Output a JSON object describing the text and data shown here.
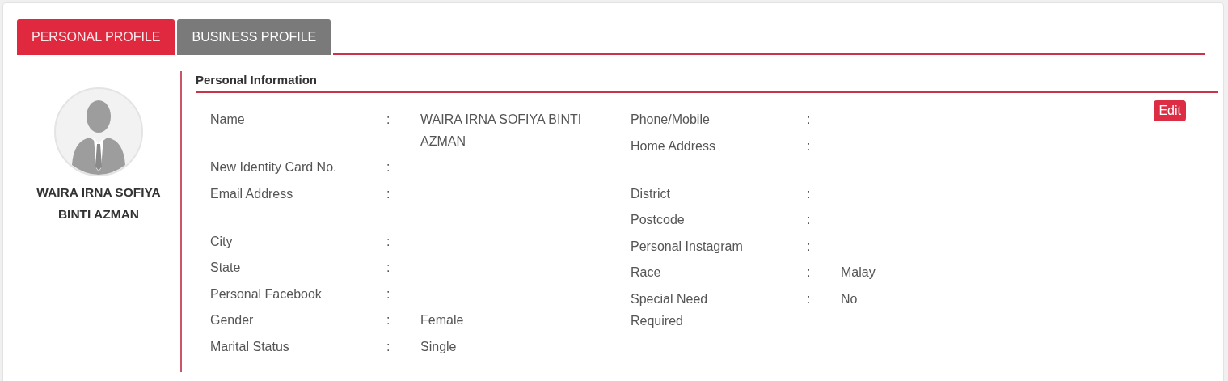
{
  "tabs": [
    {
      "label": "PERSONAL PROFILE",
      "selected": true
    },
    {
      "label": "BUSINESS PROFILE",
      "selected": false
    }
  ],
  "profile": {
    "name": "WAIRA IRNA SOFIYA BINTI AZMAN"
  },
  "section": {
    "title": "Personal Information",
    "edit_button": "Edit"
  },
  "left_fields": [
    {
      "label": "Name",
      "colon": ":",
      "value": "WAIRA IRNA SOFIYA BINTI AZMAN"
    },
    {
      "label": "New Identity Card No.",
      "colon": ":"
    },
    {
      "label": "Email Address",
      "colon": ":"
    },
    {
      "label": "City",
      "colon": ":"
    },
    {
      "label": "State",
      "colon": ":"
    },
    {
      "label": "Personal Facebook",
      "colon": ":"
    },
    {
      "label": "Gender",
      "colon": ":",
      "value": "Female"
    },
    {
      "label": "Marital Status",
      "colon": ":",
      "value": "Single"
    }
  ],
  "right_fields": [
    {
      "label": "Phone/Mobile",
      "colon": ":"
    },
    {
      "label": "Home Address",
      "colon": ":"
    },
    {
      "label": "District",
      "colon": ":"
    },
    {
      "label": "Postcode",
      "colon": ":"
    },
    {
      "label": "Personal Instagram",
      "colon": ":"
    },
    {
      "label": "Race",
      "colon": ":",
      "value": "Malay"
    },
    {
      "label": "Special Need Required",
      "colon": ":",
      "value": "No"
    }
  ]
}
